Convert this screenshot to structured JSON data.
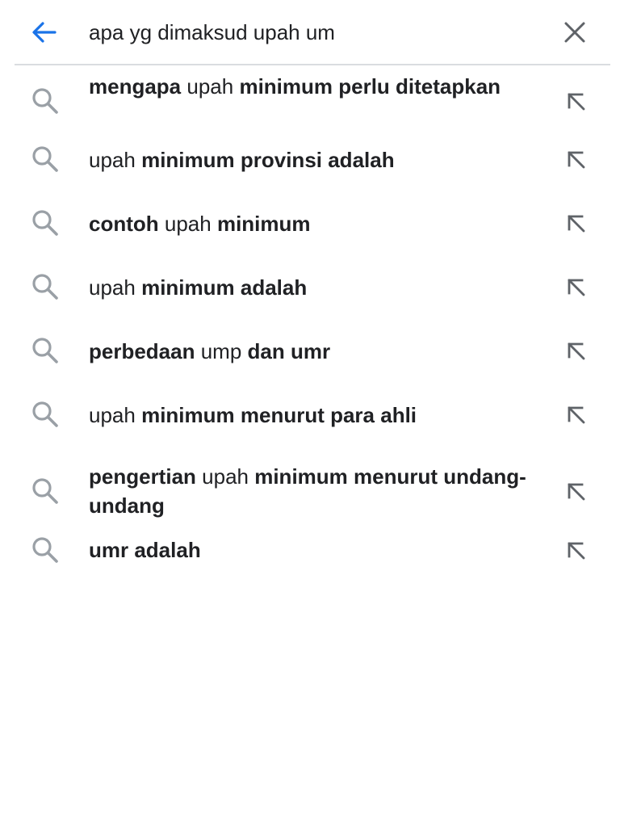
{
  "search": {
    "query": "apa yg dimaksud upah um",
    "back_icon": "arrow-left-icon",
    "clear_icon": "close-icon",
    "accent_color": "#1a73e8"
  },
  "suggestions": [
    {
      "parts": [
        {
          "t": "mengapa",
          "b": true
        },
        {
          "t": " upah ",
          "b": false
        },
        {
          "t": "minimum perlu ditetapkan",
          "b": true
        }
      ]
    },
    {
      "parts": [
        {
          "t": "upah ",
          "b": false
        },
        {
          "t": "minimum provinsi adalah",
          "b": true
        }
      ]
    },
    {
      "parts": [
        {
          "t": "contoh",
          "b": true
        },
        {
          "t": " upah ",
          "b": false
        },
        {
          "t": "minimum",
          "b": true
        }
      ]
    },
    {
      "parts": [
        {
          "t": "upah ",
          "b": false
        },
        {
          "t": "minimum adalah",
          "b": true
        }
      ]
    },
    {
      "parts": [
        {
          "t": "perbedaan",
          "b": true
        },
        {
          "t": " ump ",
          "b": false
        },
        {
          "t": "dan umr",
          "b": true
        }
      ]
    },
    {
      "parts": [
        {
          "t": "upah ",
          "b": false
        },
        {
          "t": "minimum menurut para ahli",
          "b": true
        }
      ]
    },
    {
      "parts": [
        {
          "t": "pengertian",
          "b": true
        },
        {
          "t": " upah ",
          "b": false
        },
        {
          "t": "minimum menurut undang-undang",
          "b": true
        }
      ]
    },
    {
      "parts": [
        {
          "t": "umr adalah",
          "b": true
        }
      ]
    }
  ],
  "icons": {
    "suggestion_icon": "search-icon",
    "fill_icon": "arrow-up-left-icon"
  }
}
